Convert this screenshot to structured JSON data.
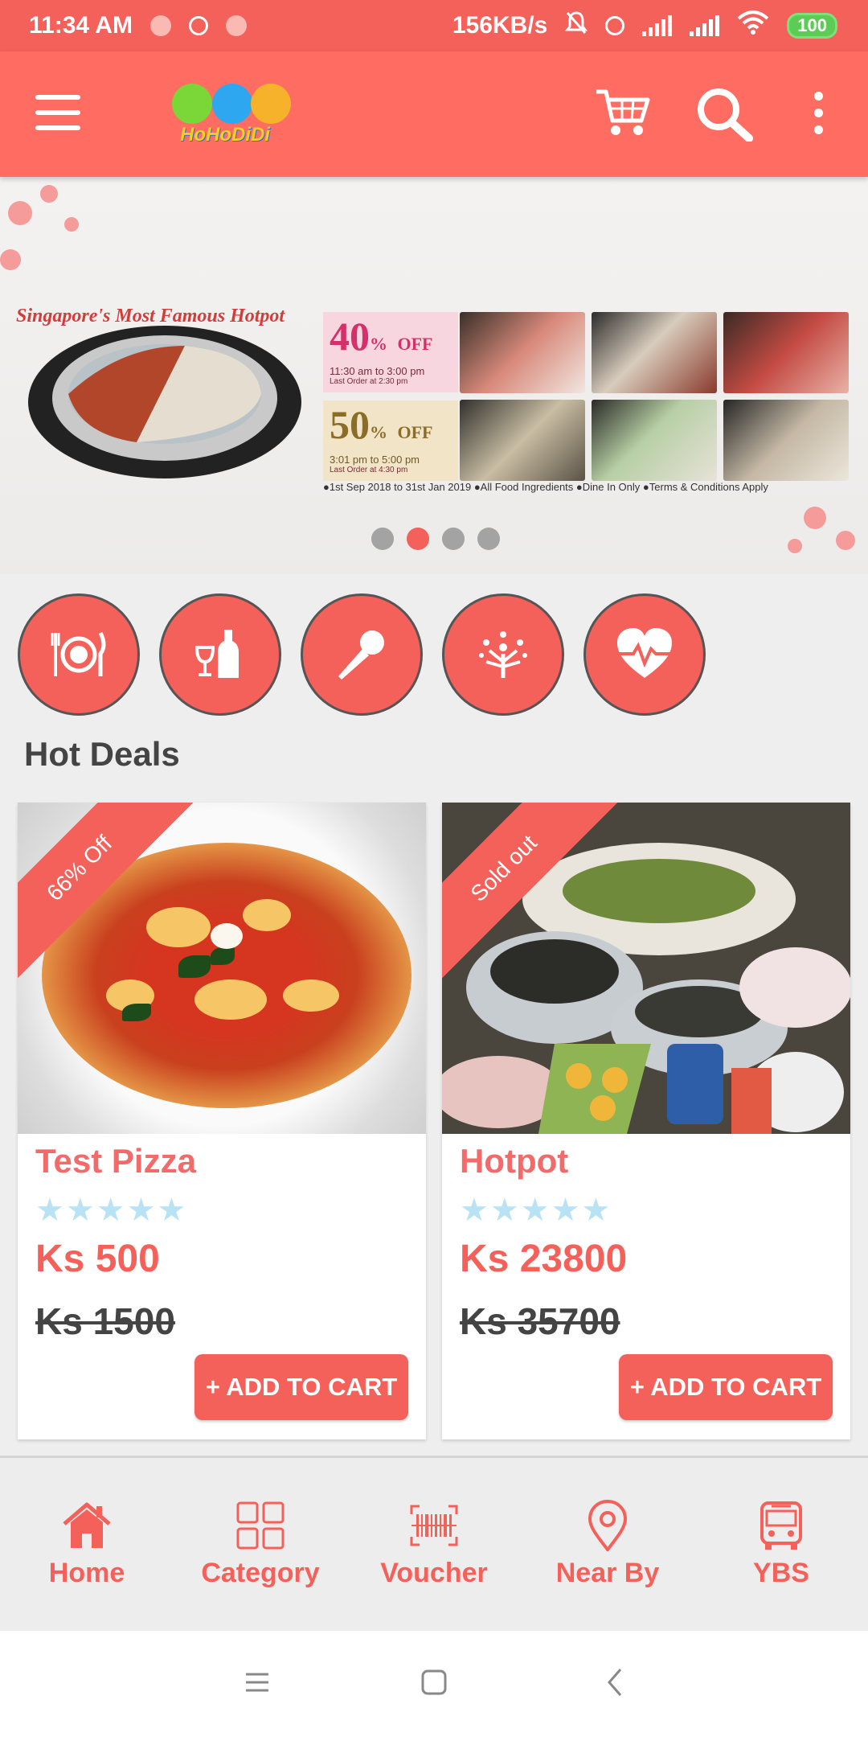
{
  "status_bar": {
    "time": "11:34 AM",
    "speed": "156KB/s",
    "battery": "100"
  },
  "app": {
    "logo_text": "HoHoDiDi"
  },
  "banner": {
    "headline": "Singapore's Most Famous Hotpot",
    "offer1": {
      "pct": "40",
      "suffix": "OFF",
      "time": "11:30 am to 3:00 pm",
      "note": "Last Order at 2:30 pm"
    },
    "offer2": {
      "pct": "50",
      "suffix": "OFF",
      "time": "3:01 pm to 5:00 pm",
      "note": "Last Order at 4:30 pm"
    },
    "fineprint": "●1st Sep 2018 to 31st Jan 2019  ●All Food Ingredients  ●Dine In Only  ●Terms & Conditions Apply",
    "active_slide": 2,
    "slide_count": 4
  },
  "categories": [
    {
      "icon": "dining-icon"
    },
    {
      "icon": "drinks-icon"
    },
    {
      "icon": "karaoke-icon"
    },
    {
      "icon": "wellness-icon"
    },
    {
      "icon": "health-icon"
    }
  ],
  "hot_deals": {
    "title": "Hot Deals",
    "items": [
      {
        "badge": "66% Off",
        "name": "Test Pizza",
        "price": "Ks 500",
        "old_price": "Ks 1500",
        "rating": 0,
        "button": "+ ADD TO CART"
      },
      {
        "badge": "Sold out",
        "name": "Hotpot",
        "price": "Ks 23800",
        "old_price": "Ks 35700",
        "rating": 0,
        "button": "+ ADD TO CART"
      }
    ]
  },
  "bottom_nav": [
    {
      "label": "Home",
      "icon": "home-icon"
    },
    {
      "label": "Category",
      "icon": "grid-icon"
    },
    {
      "label": "Voucher",
      "icon": "barcode-icon"
    },
    {
      "label": "Near By",
      "icon": "location-pin-icon"
    },
    {
      "label": "YBS",
      "icon": "bus-icon"
    }
  ],
  "colors": {
    "primary": "#f4605a",
    "appbar": "#fe6c62",
    "star": "#b9e3f5"
  }
}
